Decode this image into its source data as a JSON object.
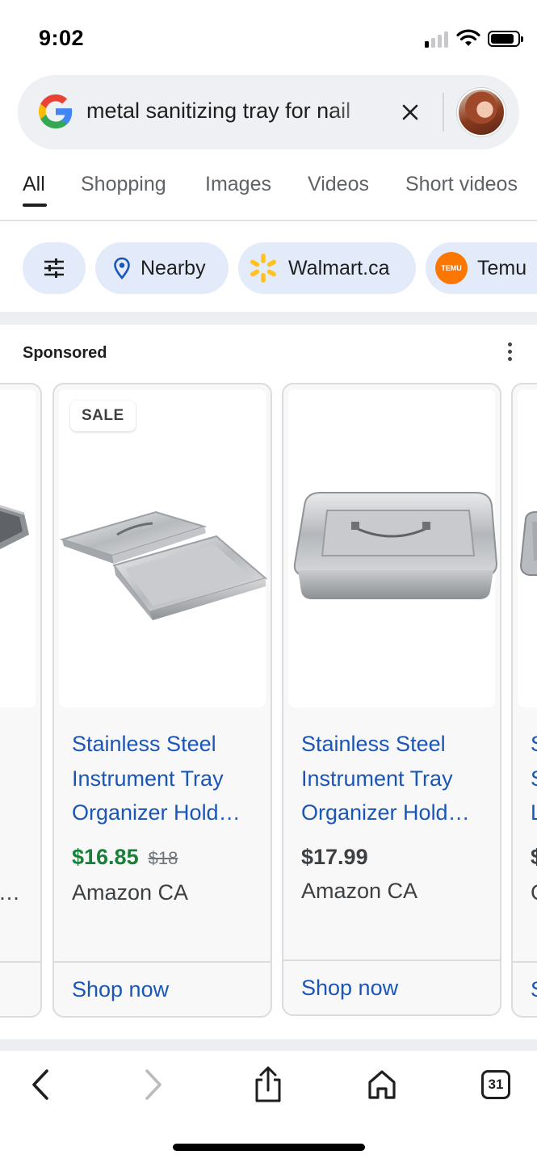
{
  "status_bar": {
    "time": "9:02"
  },
  "search": {
    "query": "metal sanitizing tray for nail",
    "clear_icon": "close-icon",
    "avatar_icon": "profile-avatar"
  },
  "tabs": [
    {
      "label": "All",
      "active": true
    },
    {
      "label": "Shopping",
      "active": false
    },
    {
      "label": "Images",
      "active": false
    },
    {
      "label": "Videos",
      "active": false
    },
    {
      "label": "Short videos",
      "active": false
    }
  ],
  "chips": [
    {
      "label": "",
      "icon": "filter-sliders-icon"
    },
    {
      "label": "Nearby",
      "icon": "location-pin-icon"
    },
    {
      "label": "Walmart.ca",
      "icon": "walmart-spark-icon"
    },
    {
      "label": "Temu",
      "icon": "temu-logo-icon",
      "icon_text": "TEMU"
    }
  ],
  "sponsored": {
    "label": "Sponsored"
  },
  "products": [
    {
      "badge": "SALE",
      "title_lines": [
        "Stainless Steel",
        "Instrument Tray",
        "Organizer Hold…"
      ],
      "price": "$16.85",
      "old_price": "$18",
      "merchant": "Amazon CA",
      "cta": "Shop now"
    },
    {
      "badge": "",
      "title_lines": [
        "Stainless Steel",
        "Instrument Tray",
        "Organizer Hold…"
      ],
      "price": "$17.99",
      "old_price": "",
      "merchant": "Amazon CA",
      "cta": "Shop now"
    }
  ],
  "partial_cards": {
    "left": {
      "merchant_fragment": "…"
    },
    "right": {
      "title_lines": [
        "S",
        "S",
        "L"
      ],
      "price_fragment": "$",
      "merchant_fragment": "C",
      "cta_fragment": "S"
    }
  },
  "toolbar": {
    "back_icon": "back-arrow-icon",
    "forward_icon": "forward-arrow-icon",
    "share_icon": "share-icon",
    "home_icon": "home-icon",
    "tab_count": "31"
  },
  "colors": {
    "link": "#1a56b7",
    "sale_price": "#188038",
    "chip_bg": "#e3ebfb",
    "search_bg": "#eef0f3"
  }
}
